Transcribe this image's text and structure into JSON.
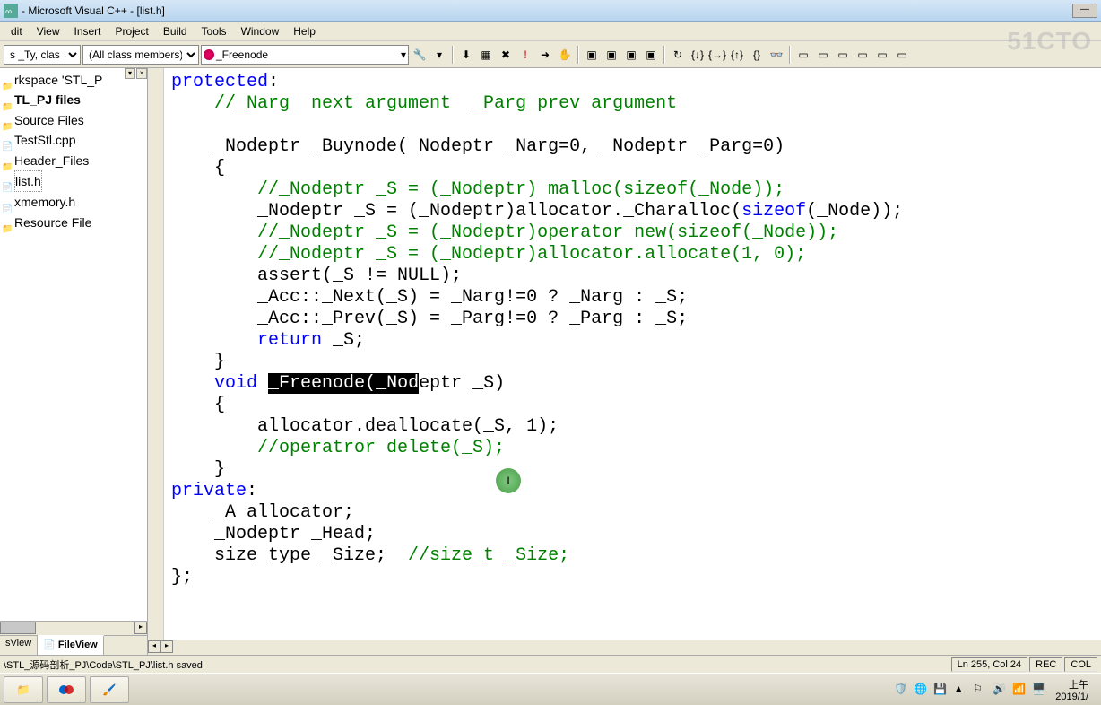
{
  "titlebar": {
    "text": "- Microsoft Visual C++ - [list.h]"
  },
  "menu": [
    "dit",
    "View",
    "Insert",
    "Project",
    "Build",
    "Tools",
    "Window",
    "Help"
  ],
  "combos": {
    "c1": "s _Ty, clas",
    "c2": "(All class members)",
    "c3": "_Freenode"
  },
  "sidebar": {
    "items": [
      {
        "label": "rkspace 'STL_P",
        "type": "folder"
      },
      {
        "label": "TL_PJ files",
        "type": "folder",
        "bold": true
      },
      {
        "label": "Source Files",
        "type": "folder"
      },
      {
        "label": "TestStl.cpp",
        "type": "file"
      },
      {
        "label": "Header_Files",
        "type": "folder"
      },
      {
        "label": "list.h",
        "type": "file",
        "selected": true
      },
      {
        "label": "xmemory.h",
        "type": "file"
      },
      {
        "label": "Resource File",
        "type": "folder"
      }
    ],
    "tabs": [
      {
        "label": "sView",
        "active": false
      },
      {
        "label": "FileView",
        "active": true
      }
    ]
  },
  "code": {
    "lines": [
      {
        "t": "protected",
        "kw": true,
        "suffix": ":"
      },
      {
        "t": "    //_Narg  next argument  _Parg prev argument",
        "comment": true
      },
      {
        "t": ""
      },
      {
        "t": "    _Nodeptr _Buynode(_Nodeptr _Narg=0, _Nodeptr _Parg=0)"
      },
      {
        "t": "    {"
      },
      {
        "t": "        //_Nodeptr _S = (_Nodeptr) malloc(sizeof(_Node));",
        "comment": true
      },
      {
        "mixed": true,
        "parts": [
          {
            "t": "        _Nodeptr _S = (_Nodeptr)allocator._Charalloc("
          },
          {
            "t": "sizeof",
            "kw": true
          },
          {
            "t": "(_Node));"
          }
        ]
      },
      {
        "t": "        //_Nodeptr _S = (_Nodeptr)operator new(sizeof(_Node));",
        "comment": true
      },
      {
        "t": "        //_Nodeptr _S = (_Nodeptr)allocator.allocate(1, 0);",
        "comment": true
      },
      {
        "t": "        assert(_S != NULL);"
      },
      {
        "t": "        _Acc::_Next(_S) = _Narg!=0 ? _Narg : _S;"
      },
      {
        "t": "        _Acc::_Prev(_S) = _Parg!=0 ? _Parg : _S;"
      },
      {
        "mixed": true,
        "parts": [
          {
            "t": "        "
          },
          {
            "t": "return",
            "kw": true
          },
          {
            "t": " _S;"
          }
        ]
      },
      {
        "t": "    }"
      },
      {
        "mixed": true,
        "parts": [
          {
            "t": "    "
          },
          {
            "t": "void",
            "kw": true
          },
          {
            "t": " "
          },
          {
            "t": "_Freenode(_Nod",
            "hl": true
          },
          {
            "t": "eptr _S)"
          }
        ]
      },
      {
        "t": "    {"
      },
      {
        "t": "        allocator.deallocate(_S, 1);"
      },
      {
        "t": "        //operatror delete(_S);",
        "comment": true
      },
      {
        "t": "    }"
      },
      {
        "t": "private",
        "kw": true,
        "suffix": ":"
      },
      {
        "t": "    _A allocator;"
      },
      {
        "t": "    _Nodeptr _Head;"
      },
      {
        "mixed": true,
        "parts": [
          {
            "t": "    size_type _Size;  "
          },
          {
            "t": "//size_t _Size;",
            "comment": true
          }
        ]
      },
      {
        "t": "};"
      }
    ]
  },
  "cursor_indicator": "I",
  "watermark": "51CTO",
  "status": {
    "left": "\\STL_源码剖析_PJ\\Code\\STL_PJ\\list.h saved",
    "pos": "Ln 255, Col 24",
    "rec": "REC",
    "col": "COL"
  },
  "clock": {
    "line1": "上午",
    "line2": "2019/1/"
  }
}
